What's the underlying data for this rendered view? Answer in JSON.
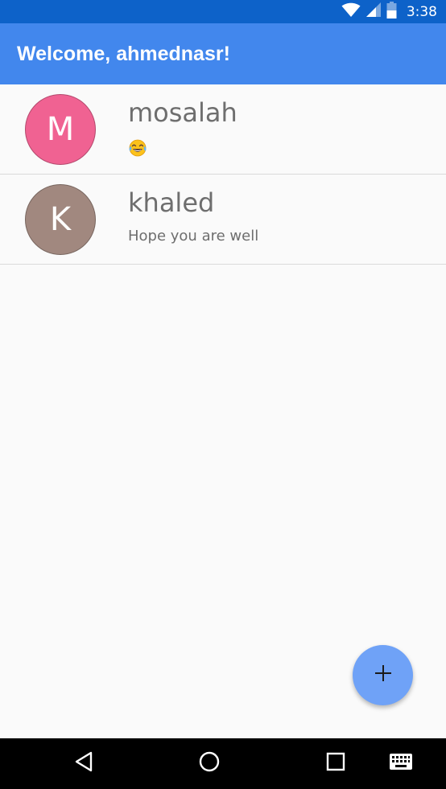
{
  "status_bar": {
    "time": "3:38",
    "bg_color": "#0d62c9",
    "icons": [
      "wifi-icon",
      "cell-signal-icon",
      "battery-icon"
    ]
  },
  "app_bar": {
    "title": "Welcome, ahmednasr!",
    "bg_color": "#4287ed"
  },
  "chats": [
    {
      "initial": "M",
      "name": "mosalah",
      "message": "",
      "message_icon": "tears-of-joy-emoji-icon",
      "avatar_color": "#f06292"
    },
    {
      "initial": "K",
      "name": "khaled",
      "message": "Hope you are well",
      "avatar_color": "#a1887f"
    }
  ],
  "fab": {
    "icon": "plus-icon",
    "color": "#6fa2f7"
  },
  "nav_bar": {
    "buttons": [
      "back-icon",
      "home-icon",
      "recents-icon",
      "keyboard-icon"
    ]
  }
}
